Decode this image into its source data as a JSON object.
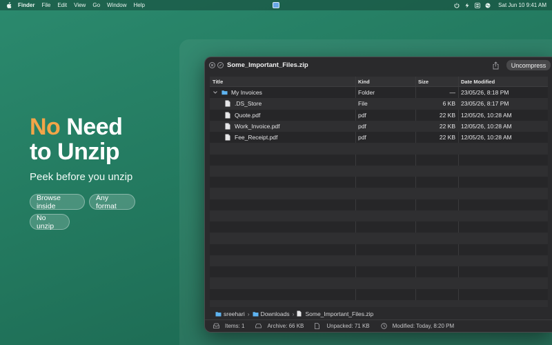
{
  "menubar": {
    "app_name": "Finder",
    "items": [
      "File",
      "Edit",
      "View",
      "Go",
      "Window",
      "Help"
    ],
    "clock": "Sat Jun 10 9:41 AM"
  },
  "hero": {
    "title_accent": "No",
    "title_rest_1": " Need",
    "title_rest_2": "to Unzip",
    "subtitle": "Peek before you unzip",
    "pills": [
      "Browse inside",
      "Any format",
      "No unzip"
    ],
    "accent_color": "#f3a548"
  },
  "window": {
    "title": "Some_Important_Files.zip",
    "uncompress_label": "Uncompress",
    "columns": [
      "Title",
      "Kind",
      "Size",
      "Date Modified"
    ],
    "rows": [
      {
        "name": "My Invoices",
        "kind": "Folder",
        "size": "—",
        "date": "23/05/26, 8:18 PM",
        "type": "folder",
        "expanded": true,
        "level": 0
      },
      {
        "name": ".DS_Store",
        "kind": "File",
        "size": "6 KB",
        "date": "23/05/26, 8:17 PM",
        "type": "file",
        "level": 1
      },
      {
        "name": "Quote.pdf",
        "kind": "pdf",
        "size": "22 KB",
        "date": "12/05/26, 10:28 AM",
        "type": "file",
        "level": 1
      },
      {
        "name": "Work_Invoice.pdf",
        "kind": "pdf",
        "size": "22 KB",
        "date": "12/05/26, 10:28 AM",
        "type": "file",
        "level": 1
      },
      {
        "name": "Fee_Receipt.pdf",
        "kind": "pdf",
        "size": "22 KB",
        "date": "12/05/26, 10:28 AM",
        "type": "file",
        "level": 1
      }
    ],
    "path": [
      "sreehari",
      "Downloads",
      "Some_Important_Files.zip"
    ],
    "status": {
      "items": "Items: 1",
      "archive": "Archive: 66 KB",
      "unpacked": "Unpacked: 71 KB",
      "modified": "Modified: Today, 8:20 PM"
    }
  }
}
